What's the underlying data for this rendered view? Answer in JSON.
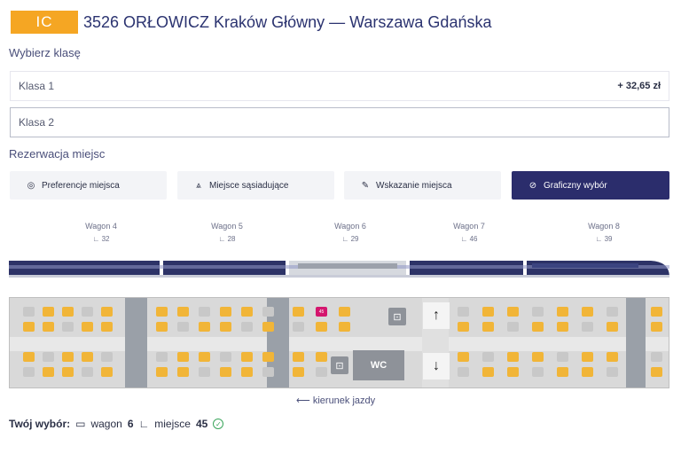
{
  "header": {
    "logo": "IC",
    "title": "3526 ORŁOWICZ Kraków Główny — Warszawa Gdańska"
  },
  "class_section": {
    "label": "Wybierz klasę",
    "options": [
      {
        "label": "Klasa 1",
        "price": "+ 32,65 zł"
      },
      {
        "label": "Klasa 2",
        "price": ""
      }
    ],
    "selected": "Klasa 2"
  },
  "reservation": {
    "label": "Rezerwacja miejsc",
    "options": [
      {
        "label": "Preferencje miejsca",
        "icon": "target-icon"
      },
      {
        "label": "Miejsce sąsiadujące",
        "icon": "people-icon"
      },
      {
        "label": "Wskazanie miejsca",
        "icon": "pencil-icon"
      },
      {
        "label": "Graficzny wybór",
        "icon": "check-circle-icon"
      }
    ],
    "active": "Graficzny wybór"
  },
  "wagons": [
    {
      "label": "Wagon 4",
      "seats": "32"
    },
    {
      "label": "Wagon 5",
      "seats": "28"
    },
    {
      "label": "Wagon 6",
      "seats": "29"
    },
    {
      "label": "Wagon 7",
      "seats": "46"
    },
    {
      "label": "Wagon 8",
      "seats": "39"
    }
  ],
  "seat_numbers": {
    "selected": "45",
    "wc_label": "WC"
  },
  "direction": "kierunek jazdy",
  "summary": {
    "label": "Twój wybór:",
    "wagon_text": "wagon",
    "wagon_value": "6",
    "seat_text": "miejsce",
    "seat_value": "45"
  },
  "colors": {
    "brand_orange": "#f5a623",
    "active_button": "#2b2d6c",
    "seat_free": "#f1b538",
    "seat_selected": "#d4166e"
  }
}
